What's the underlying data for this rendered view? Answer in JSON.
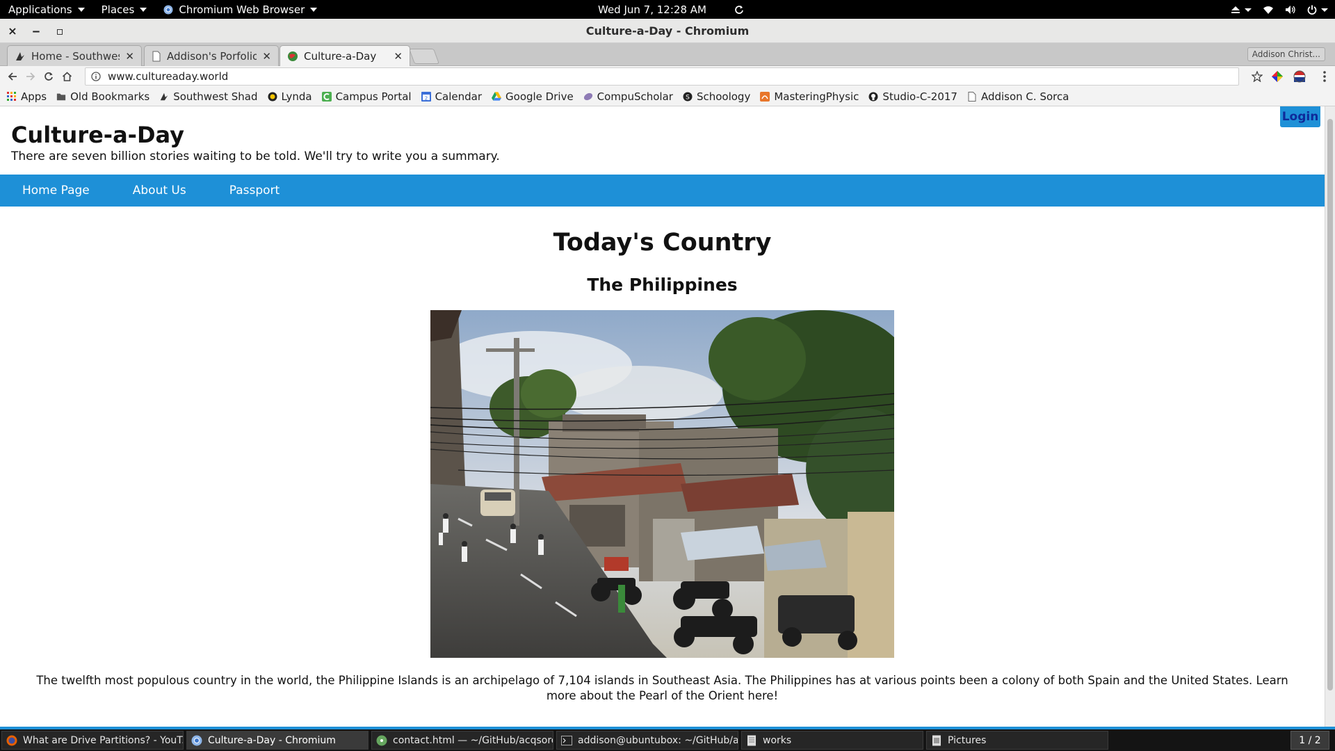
{
  "topbar": {
    "applications": "Applications",
    "places": "Places",
    "browser_menu": "Chromium Web Browser",
    "datetime": "Wed Jun  7, 12:28 AM"
  },
  "window": {
    "title": "Culture-a-Day - Chromium",
    "close": "×",
    "minimize": "‒",
    "maximize": "▫"
  },
  "tabs": [
    {
      "label": "Home - Southwest S",
      "icon": "southwest-icon"
    },
    {
      "label": "Addison's Porfolio:",
      "icon": "page-icon"
    },
    {
      "label": "Culture-a-Day",
      "icon": "globe-icon",
      "active": true
    }
  ],
  "profile_name": "Addison Christ...",
  "address": {
    "url": "www.cultureaday.world"
  },
  "bookmarks": [
    {
      "label": "Apps",
      "icon": "apps-grid-icon"
    },
    {
      "label": "Old Bookmarks",
      "icon": "folder-icon"
    },
    {
      "label": "Southwest Shad",
      "icon": "southwest-icon"
    },
    {
      "label": "Lynda",
      "icon": "lynda-icon"
    },
    {
      "label": "Campus Portal",
      "icon": "campus-portal-icon"
    },
    {
      "label": "Calendar",
      "icon": "calendar-icon"
    },
    {
      "label": "Google Drive",
      "icon": "drive-icon"
    },
    {
      "label": "CompuScholar",
      "icon": "compuscholar-icon"
    },
    {
      "label": "Schoology",
      "icon": "schoology-icon"
    },
    {
      "label": "MasteringPhysic",
      "icon": "mastering-icon"
    },
    {
      "label": "Studio-C-2017",
      "icon": "github-icon"
    },
    {
      "label": "Addison C. Sorca",
      "icon": "page-icon"
    }
  ],
  "site": {
    "title": "Culture-a-Day",
    "tagline": "There are seven billion stories waiting to be told. We'll try to write you a summary.",
    "login": "Login",
    "nav": [
      "Home Page",
      "About Us",
      "Passport"
    ],
    "heading": "Today's Country",
    "country": "The Philippines",
    "description": "The twelfth most populous country in the world, the Philippine Islands is an archipelago of 7,104 islands in Southeast Asia. The Philippines has at various points been a colony of both Spain and the United States. Learn more about the Pearl of the Orient here!"
  },
  "taskbar": {
    "items": [
      {
        "label": "What are Drive Partitions? - YouT...",
        "icon": "firefox-icon"
      },
      {
        "label": "Culture-a-Day - Chromium",
        "icon": "chromium-icon",
        "active": true
      },
      {
        "label": "contact.html — ~/GitHub/acqsorc...",
        "icon": "atom-icon"
      },
      {
        "label": "addison@ubuntubox: ~/GitHub/ac...",
        "icon": "terminal-icon"
      },
      {
        "label": "works",
        "icon": "document-icon"
      },
      {
        "label": "Pictures",
        "icon": "files-icon"
      }
    ],
    "workspace": "1 / 2"
  },
  "colors": {
    "accent": "#1e90d7",
    "login_text": "#0e2a9a"
  }
}
